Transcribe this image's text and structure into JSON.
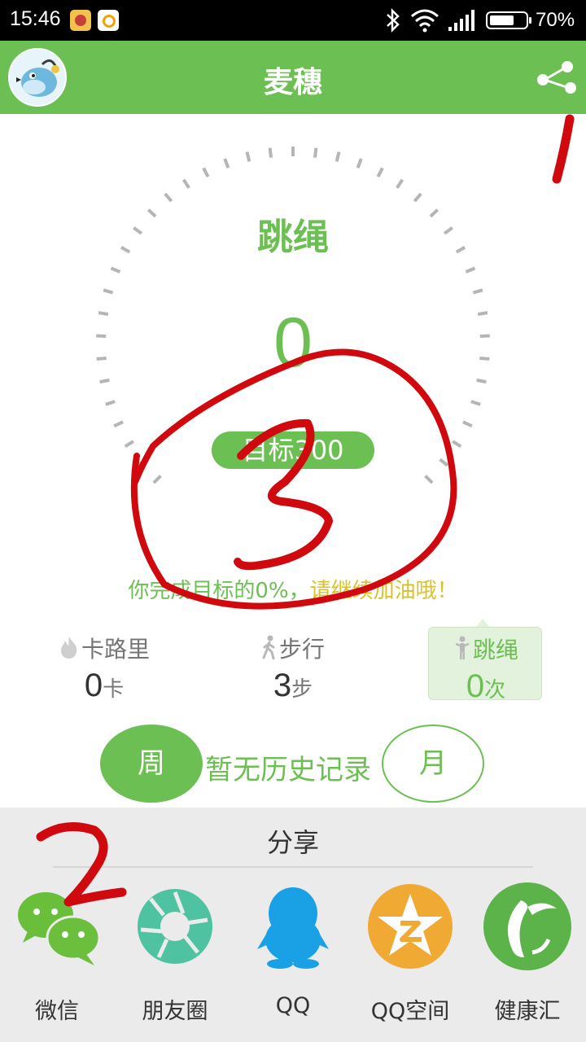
{
  "status_bar": {
    "time": "15:46",
    "battery_percent": "70%",
    "battery_level": 0.7
  },
  "header": {
    "title": "麦穗"
  },
  "gauge": {
    "activity": "跳绳",
    "count": "0",
    "goal": "目标300",
    "progress_prefix": "你完成目标的0%，",
    "progress_suffix": "请继续加油哦！"
  },
  "stats": [
    {
      "label": "卡路里",
      "value": "0",
      "unit": "卡",
      "icon": "flame-icon"
    },
    {
      "label": "步行",
      "value": "3",
      "unit": "步",
      "icon": "walker-icon"
    },
    {
      "label": "跳绳",
      "value": "0",
      "unit": "次",
      "icon": "jump-rope-icon"
    }
  ],
  "period": {
    "week": "周",
    "history": "暂无历史记录",
    "month": "月"
  },
  "share": {
    "title": "分享",
    "items": [
      {
        "label": "微信",
        "icon": "wechat-icon",
        "color": "#6cbf3f"
      },
      {
        "label": "朋友圈",
        "icon": "moments-icon",
        "color": "#4fc3a1"
      },
      {
        "label": "QQ",
        "icon": "qq-icon",
        "color": "#1aa1e5"
      },
      {
        "label": "QQ空间",
        "icon": "qzone-icon",
        "color": "#f0a932"
      },
      {
        "label": "健康汇",
        "icon": "health-hub-icon",
        "color": "#5cb34a"
      }
    ]
  },
  "annotations": [
    "1",
    "2",
    "3"
  ],
  "colors": {
    "accent": "#6cbf52",
    "annotation": "#d0090f"
  }
}
